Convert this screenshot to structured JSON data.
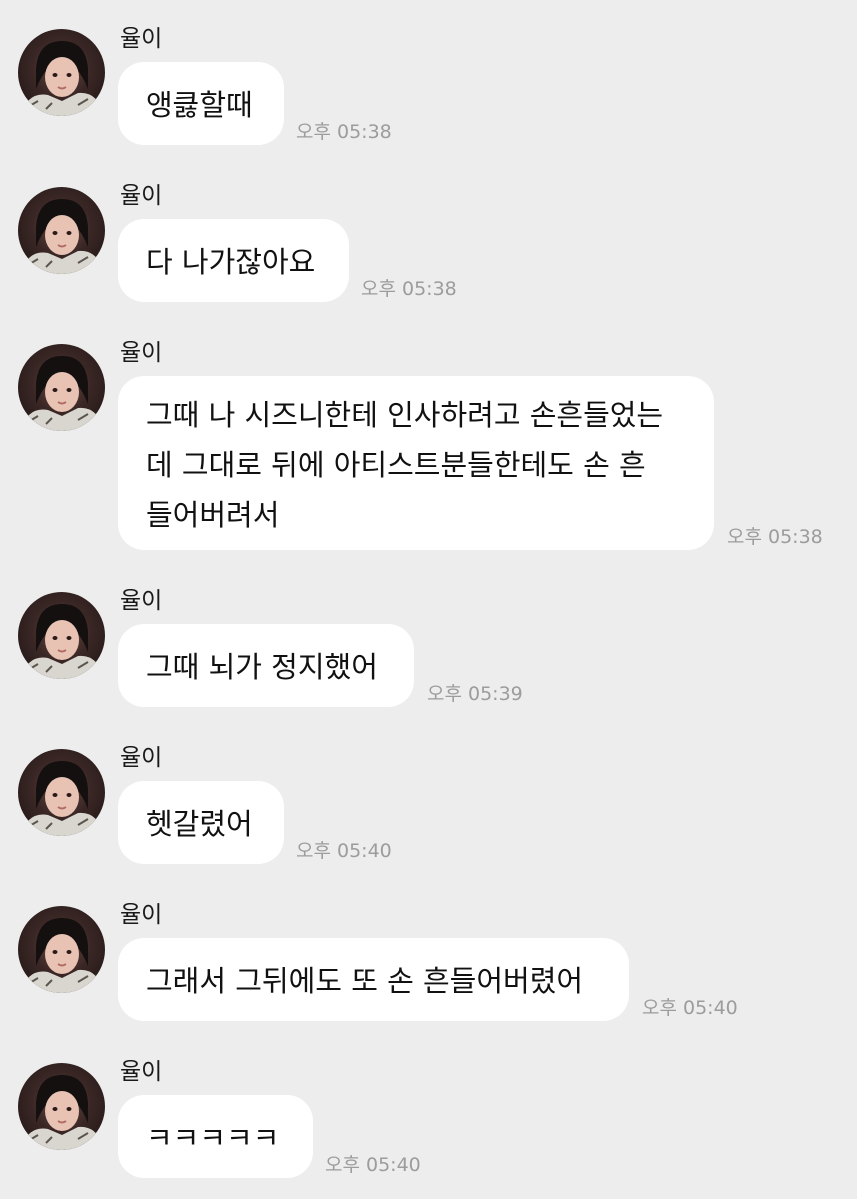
{
  "chat": {
    "messages": [
      {
        "sender": "율이",
        "text": "앵큻할때",
        "time": "오후 05:38"
      },
      {
        "sender": "율이",
        "text": "다 나가잖아요",
        "time": "오후 05:38"
      },
      {
        "sender": "율이",
        "lines": [
          "그때 나 시즈니한테 인사하려고 손흔들었는",
          "데 그대로 뒤에 아티스트분들한테도 손 흔",
          "들어버려서"
        ],
        "time": "오후 05:38"
      },
      {
        "sender": "율이",
        "text": "그때 뇌가 정지했어",
        "time": "오후 05:39"
      },
      {
        "sender": "율이",
        "text": "헷갈렸어",
        "time": "오후 05:40"
      },
      {
        "sender": "율이",
        "text": "그래서 그뒤에도 또 손 흔들어버렸어",
        "time": "오후 05:40"
      },
      {
        "sender": "율이",
        "text": "ㅋㅋㅋㅋㅋ",
        "time": "오후 05:40"
      }
    ]
  },
  "colors": {
    "background": "#ededed",
    "bubble": "#ffffff",
    "time_text": "#9c9c9c"
  },
  "icons": {
    "avatar": "profile-photo"
  }
}
